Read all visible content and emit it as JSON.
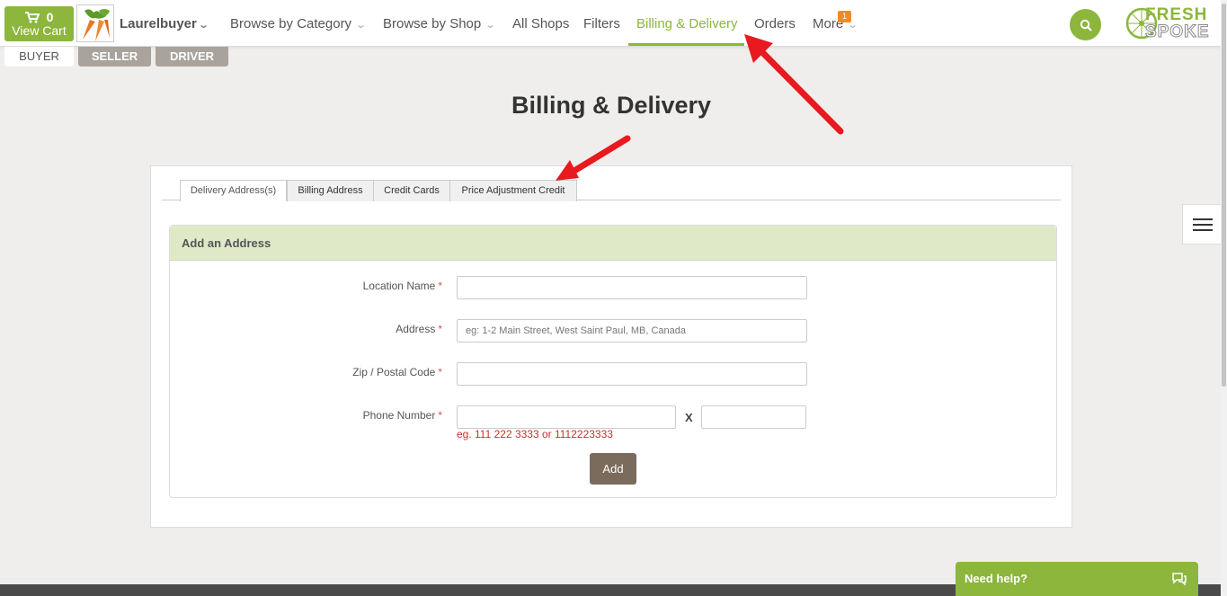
{
  "cart": {
    "count": "0",
    "label": "View Cart"
  },
  "user": {
    "name": "Laurelbuyer"
  },
  "nav": {
    "items": [
      {
        "label": "Browse by Category",
        "chevron": true
      },
      {
        "label": "Browse by Shop",
        "chevron": true
      },
      {
        "label": "All Shops"
      },
      {
        "label": "Filters"
      },
      {
        "label": "Billing & Delivery",
        "active": true
      },
      {
        "label": "Orders"
      },
      {
        "label": "More",
        "chevron": true,
        "badge": "1"
      }
    ]
  },
  "logo": {
    "line1": "FRESH",
    "line2": "SPOKE"
  },
  "roles": {
    "buyer": "BUYER",
    "seller": "SELLER",
    "driver": "DRIVER"
  },
  "page": {
    "title": "Billing & Delivery"
  },
  "tabs": [
    {
      "label": "Delivery Address(s)",
      "active": true
    },
    {
      "label": "Billing Address"
    },
    {
      "label": "Credit Cards"
    },
    {
      "label": "Price Adjustment Credit"
    }
  ],
  "form": {
    "heading": "Add an Address",
    "location_label": "Location Name",
    "address_label": "Address",
    "address_placeholder": "eg: 1-2 Main Street, West Saint Paul, MB, Canada",
    "zip_label": "Zip / Postal Code",
    "phone_label": "Phone Number",
    "required_mark": "*",
    "ext_separator": "X",
    "phone_hint": "eg. 111 222 3333 or 1112223333",
    "submit_label": "Add"
  },
  "help": {
    "label": "Need help?"
  },
  "colors": {
    "brand_green": "#8cb63c",
    "header_green": "#dfe9c8",
    "button_brown": "#7b6b5c",
    "annotation_red": "#e8191f"
  }
}
